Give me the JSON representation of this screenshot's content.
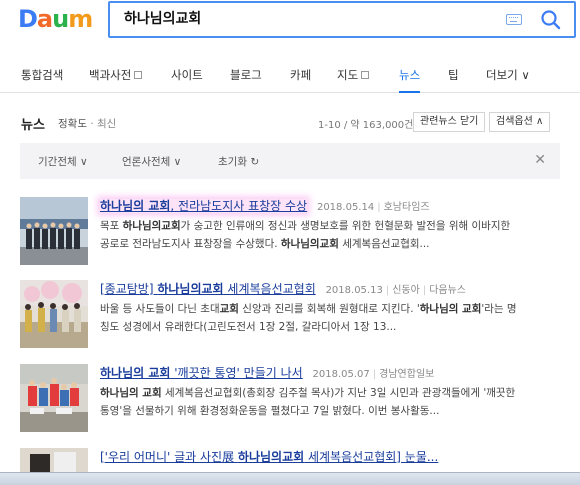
{
  "search": {
    "query": "하나님의교회"
  },
  "tabs": [
    {
      "label": "통합검색"
    },
    {
      "label": "백과사전"
    },
    {
      "label": "사이트"
    },
    {
      "label": "블로그"
    },
    {
      "label": "카페"
    },
    {
      "label": "지도"
    },
    {
      "label": "뉴스"
    },
    {
      "label": "팁"
    },
    {
      "label": "더보기 ∨"
    }
  ],
  "news_header": {
    "title": "뉴스",
    "sort_accuracy": "정확도",
    "sort_dot": "·",
    "sort_recent": "최신",
    "count": "1-10 / 약 163,000건",
    "related_btn": "관련뉴스 닫기",
    "options_btn": "검색옵션 ∧"
  },
  "filters": {
    "period": "기간전체 ∨",
    "press": "언론사전체 ∨",
    "reset": "초기화 ↻",
    "close": "✕"
  },
  "results": [
    {
      "title_prefix": "",
      "title_bold": "하나님의 교회",
      "title_rest": ", 전라남도지사 표창장 수상",
      "date": "2018.05.14",
      "source": "호남타임즈",
      "source2": "",
      "line1_a": "목포 ",
      "line1_b": "하나님의교회",
      "line1_c": "가 숭고한 인류애의 정신과 생명보호를 위한 헌혈문화 발전을 위해 이바지한",
      "line2_a": "공로로 전라남도지사 표창장을 수상했다. ",
      "line2_b": "하나님의교회",
      "line2_c": " 세계복음선교협회..."
    },
    {
      "title_prefix": "[종교탐방] ",
      "title_bold": "하나님의교회",
      "title_rest": " 세계복음선교협회",
      "date": "2018.05.13",
      "source": "신동아",
      "source2": "다음뉴스",
      "line1_a": "바울 등 사도들이 다닌 초대",
      "line1_b": "교회",
      "line1_c": " 신앙과 진리를 회복해 원형대로 지킨다. '",
      "line1_d": "하나님의 교회",
      "line1_e": "'라는 명",
      "line2_a": "칭도 성경에서 유래한다(고린도전서 1장 2절, 갈라디아서 1장 13...",
      "line2_b": "",
      "line2_c": ""
    },
    {
      "title_prefix": "",
      "title_bold": "하나님의 교회",
      "title_rest": " '깨끗한 통영' 만들기 나서",
      "date": "2018.05.07",
      "source": "경남연합일보",
      "source2": "",
      "line1_a": "",
      "line1_b": "하나님의 교회",
      "line1_c": " 세계복음선교협회(총회장 김주철 목사)가 지난 3일 시민과 관광객들에게 '깨끗한",
      "line2_a": "통영'을 선물하기 위해 환경정화운동을 펼쳤다고 7일 밝혔다. 이번 봉사활동...",
      "line2_b": "",
      "line2_c": ""
    },
    {
      "title_prefix": "['우리 어머니' 글과 사진展 ",
      "title_bold": "하나님의교회",
      "title_rest": " 세계복음선교협회] 눈물..."
    }
  ],
  "colors": {
    "accent": "#1a73e8",
    "link": "#1a3d9c",
    "logo_blue": "#3b7cf5",
    "logo_orange": "#f26a2a"
  }
}
